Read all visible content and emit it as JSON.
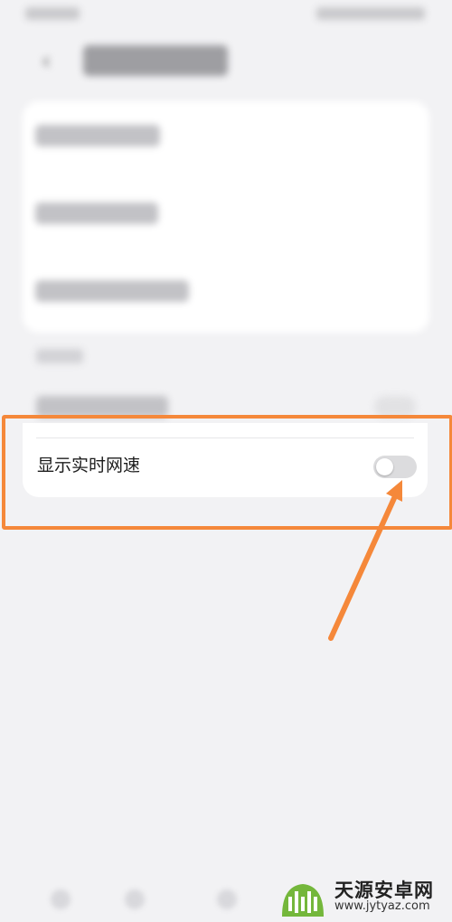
{
  "settings": {
    "realtime_speed_label": "显示实时网速",
    "realtime_speed_enabled": false
  },
  "watermark": {
    "title": "天源安卓网",
    "url": "www.jytyaz.com"
  },
  "colors": {
    "highlight": "#f5883a",
    "background": "#f2f2f4",
    "card": "#ffffff"
  },
  "icons": {
    "back": "chevron-left-icon",
    "logo": "android-robot-icon"
  }
}
